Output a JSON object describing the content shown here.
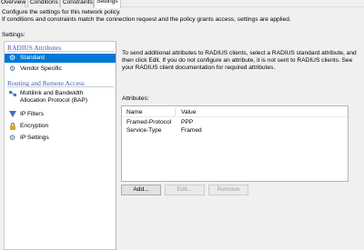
{
  "tabs": [
    {
      "label": "Overview",
      "active": false
    },
    {
      "label": "Conditions",
      "active": false
    },
    {
      "label": "Constraints",
      "active": false
    },
    {
      "label": "Settings",
      "active": true
    }
  ],
  "description_line1": "Configure the settings for this network policy.",
  "description_line2": "If conditions and constraints match the connection request and the policy grants access, settings are applied.",
  "settings_label": "Settings:",
  "nav": {
    "group1": "RADIUS Attributes",
    "standard": "Standard",
    "vendor_specific": "Vendor Specific",
    "group2": "Routing and Remote Access",
    "multilink": "Multilink and Bandwidth Allocation Protocol (BAP)",
    "ip_filters": "IP Filters",
    "encryption": "Encryption",
    "ip_settings": "IP Settings"
  },
  "main_text": "To send additional attributes to RADIUS clients, select a RADIUS standard attribute, and then click Edit. If you do not configure an attribute, it is not sent to RADIUS clients. See your RADIUS client documentation for required attributes.",
  "attributes_label": "Attributes:",
  "attributes_table": {
    "columns": [
      "Name",
      "Value"
    ],
    "rows": [
      [
        "Framed-Protocol",
        "PPP"
      ],
      [
        "Service-Type",
        "Framed"
      ]
    ]
  },
  "buttons": {
    "add": "Add...",
    "edit": "Edit...",
    "remove": "Remove"
  },
  "colors": {
    "selection": "#0078d7",
    "group_header": "#3a5ea8"
  }
}
